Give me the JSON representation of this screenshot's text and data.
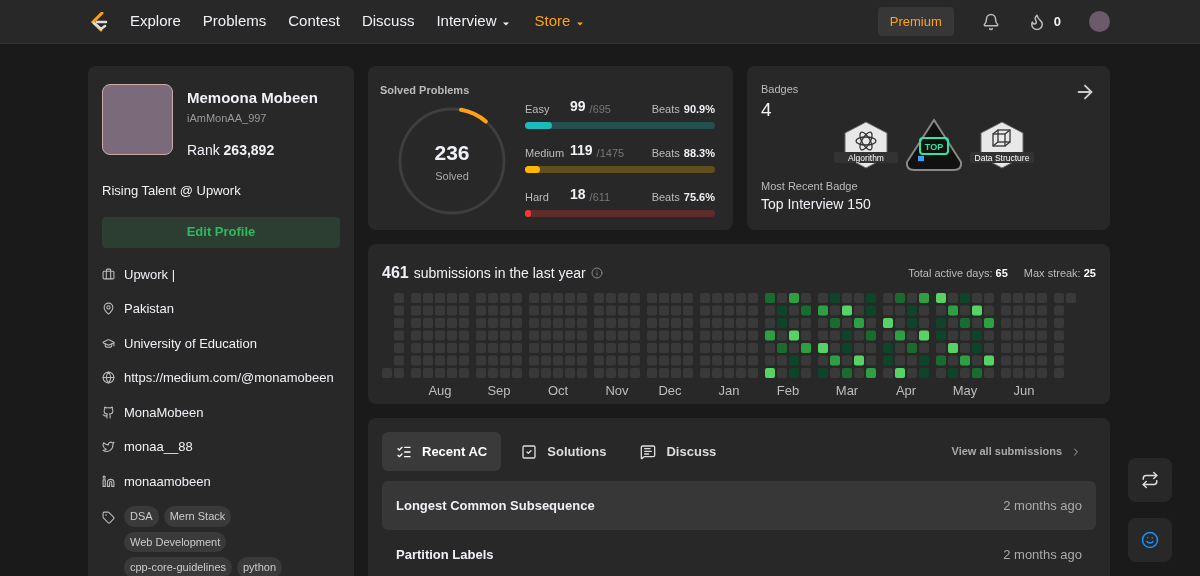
{
  "nav": {
    "items": [
      {
        "label": "Explore",
        "dropdown": false,
        "highlight": false
      },
      {
        "label": "Problems",
        "dropdown": false,
        "highlight": false
      },
      {
        "label": "Contest",
        "dropdown": false,
        "highlight": false
      },
      {
        "label": "Discuss",
        "dropdown": false,
        "highlight": false
      },
      {
        "label": "Interview",
        "dropdown": true,
        "highlight": false
      },
      {
        "label": "Store",
        "dropdown": true,
        "highlight": true
      }
    ],
    "premium": "Premium",
    "streak": "0"
  },
  "profile": {
    "name": "Memoona Mobeen",
    "username": "iAmMonAA_997",
    "rank_label": "Rank",
    "rank": "263,892",
    "headline": "Rising Talent @ Upwork",
    "edit_button": "Edit Profile",
    "details": [
      {
        "kind": "work",
        "text": "Upwork |"
      },
      {
        "kind": "location",
        "text": "Pakistan"
      },
      {
        "kind": "school",
        "text": "University of Education"
      },
      {
        "kind": "website",
        "text": "https://medium.com/@monamobeen"
      },
      {
        "kind": "github",
        "text": "MonaMobeen"
      },
      {
        "kind": "twitter",
        "text": "monaa__88"
      },
      {
        "kind": "linkedin",
        "text": "monaamobeen"
      }
    ],
    "skills": [
      "DSA",
      "Mern Stack",
      "Web Development",
      "cpp-core-guidelines",
      "python"
    ]
  },
  "solved": {
    "title": "Solved Problems",
    "count": "236",
    "caption": "Solved",
    "level": 0.085,
    "levels": [
      {
        "name": "Easy",
        "solved": "99",
        "total": "/695",
        "beats_label": "Beats",
        "beats": "90.9%",
        "level": 0.14,
        "color": "#1cbaba"
      },
      {
        "name": "Medium",
        "solved": "119",
        "total": "/1475",
        "beats_label": "Beats",
        "beats": "88.3%",
        "level": 0.08,
        "color": "#ffb700"
      },
      {
        "name": "Hard",
        "solved": "18",
        "total": "/611",
        "beats_label": "Beats",
        "beats": "75.6%",
        "level": 0.03,
        "color": "#f63737"
      }
    ]
  },
  "badges": {
    "title": "Badges",
    "count": "4",
    "items": [
      {
        "kind": "algorithm",
        "label": "Algorithm"
      },
      {
        "kind": "top",
        "label": "TOP"
      },
      {
        "kind": "structure",
        "label": "Data Structure"
      }
    ],
    "recent_label": "Most Recent Badge",
    "recent": "Top Interview 150"
  },
  "activity": {
    "count": "461",
    "caption": "submissions in the last year",
    "active_days_label": "Total active days:",
    "active_days": "65",
    "max_streak_label": "Max streak:",
    "max_streak": "25",
    "months": [
      "Aug",
      "Sep",
      "Oct",
      "Nov",
      "Dec",
      "Jan",
      "Feb",
      "Mar",
      "Apr",
      "May",
      "Jun"
    ]
  },
  "tabs": [
    {
      "kind": "recent",
      "label": "Recent AC",
      "selected": true
    },
    {
      "kind": "solutions",
      "label": "Solutions",
      "selected": false
    },
    {
      "kind": "discuss",
      "label": "Discuss",
      "selected": false
    }
  ],
  "view_all": "View all submissions",
  "submissions": [
    {
      "title": "Longest Common Subsequence",
      "time": "2 months ago"
    },
    {
      "title": "Partition Labels",
      "time": "2 months ago"
    }
  ]
}
